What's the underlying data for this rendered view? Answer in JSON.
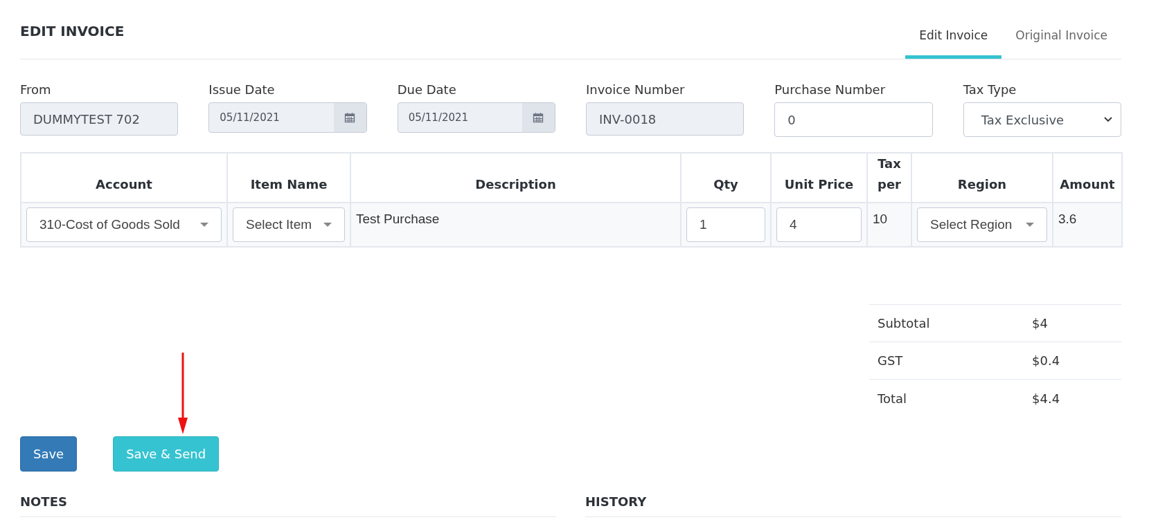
{
  "title": "EDIT INVOICE",
  "tabs": [
    {
      "label": "Edit Invoice",
      "selected": true
    },
    {
      "label": "Original Invoice",
      "selected": false
    }
  ],
  "fields": [
    {
      "label": "From",
      "kind": "readonly",
      "value": "DUMMYTEST 702"
    },
    {
      "label": "Issue Date",
      "kind": "date",
      "value": "05/11/2021"
    },
    {
      "label": "Due Date",
      "kind": "date",
      "value": "05/11/2021"
    },
    {
      "label": "Invoice Number",
      "kind": "readonly",
      "value": "INV-0018"
    },
    {
      "label": "Purchase Number",
      "kind": "input",
      "value": "0"
    },
    {
      "label": "Tax Type",
      "kind": "select",
      "value": "Tax Exclusive"
    }
  ],
  "table": {
    "columns": [
      "Account",
      "Item Name",
      "Description",
      "Qty",
      "Unit Price",
      "Tax per",
      "Region",
      "Amount"
    ],
    "rows": [
      [
        {
          "kind": "dropdown",
          "value": "310-Cost of Goods Sold"
        },
        {
          "kind": "dropdown",
          "value": "Select Item"
        },
        {
          "kind": "text",
          "value": "Test Purchase"
        },
        {
          "kind": "input",
          "value": "1"
        },
        {
          "kind": "input",
          "value": "4"
        },
        {
          "kind": "text",
          "value": "10"
        },
        {
          "kind": "dropdown",
          "value": "Select Region"
        },
        {
          "kind": "text",
          "value": "3.6"
        }
      ]
    ]
  },
  "totals": [
    {
      "label": "Subtotal",
      "value": "$4"
    },
    {
      "label": "GST",
      "value": "$0.4"
    },
    {
      "label": "Total",
      "value": "$4.4"
    }
  ],
  "buttons": [
    {
      "label": "Save",
      "kind": "primary"
    },
    {
      "label": "Save & Send",
      "kind": "info"
    }
  ],
  "sections": [
    "NOTES",
    "HISTORY"
  ]
}
